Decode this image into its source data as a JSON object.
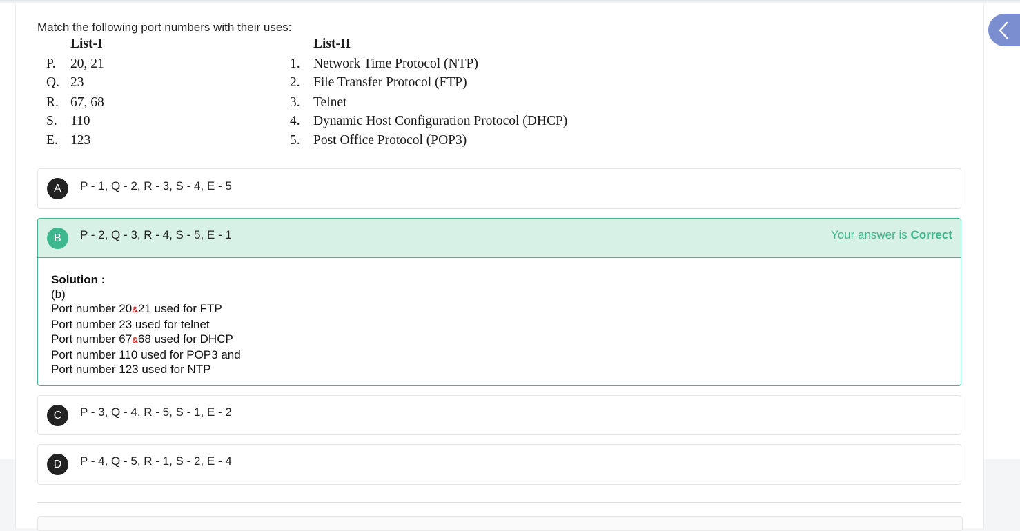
{
  "question": {
    "text": "Match the following port numbers with their uses:",
    "list1_header": "List-I",
    "list2_header": "List-II",
    "list1": [
      {
        "key": "P.",
        "value": "20, 21"
      },
      {
        "key": "Q.",
        "value": "23"
      },
      {
        "key": "R.",
        "value": "67, 68"
      },
      {
        "key": "S.",
        "value": "110"
      },
      {
        "key": "E.",
        "value": "123"
      }
    ],
    "list2": [
      {
        "key": "1.",
        "value": "Network Time Protocol (NTP)"
      },
      {
        "key": "2.",
        "value": "File Transfer Protocol (FTP)"
      },
      {
        "key": "3.",
        "value": "Telnet"
      },
      {
        "key": "4.",
        "value": "Dynamic Host Configuration Protocol (DHCP)"
      },
      {
        "key": "5.",
        "value": "Post Office Protocol (POP3)"
      }
    ]
  },
  "options": [
    {
      "letter": "A",
      "text": "P - 1, Q - 2, R - 3, S - 4, E - 5"
    },
    {
      "letter": "B",
      "text": "P - 2, Q - 3, R - 4, S - 5, E - 1"
    },
    {
      "letter": "C",
      "text": "P - 3, Q - 4, R - 5, S - 1, E - 2"
    },
    {
      "letter": "D",
      "text": "P - 4, Q - 5, R - 1, S - 2, E - 4"
    }
  ],
  "result": {
    "prefix": "Your answer is",
    "status": "Correct"
  },
  "solution": {
    "title": "Solution :",
    "answer": "(b)",
    "lines": [
      {
        "before": "Port number 20",
        "mark": "&",
        "after": "21 used for FTP"
      },
      {
        "text": "Port number 23 used for telnet"
      },
      {
        "before": "Port number 67",
        "mark": "&",
        "after": "68 used for DHCP"
      },
      {
        "text": "Port number 110 used for POP3 and"
      },
      {
        "text": "Port number 123 used for NTP"
      }
    ]
  },
  "icons": {
    "sidebar_toggle": "chevron-left-icon"
  },
  "colors": {
    "correct_accent": "#3eb88f",
    "correct_bg": "#d8f1e7",
    "toggle_bg": "#7b8fd0"
  }
}
